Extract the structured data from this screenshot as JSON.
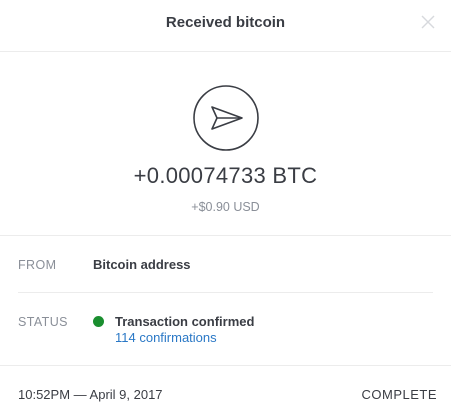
{
  "header": {
    "title": "Received bitcoin",
    "close_icon": "close-icon"
  },
  "hero": {
    "icon": "send-arrow-icon",
    "amount": "+0.00074733 BTC",
    "usd_value": "+$0.90 USD"
  },
  "details": {
    "from_label": "FROM",
    "from_value": "Bitcoin address",
    "status_label": "STATUS",
    "status_value": "Transaction confirmed",
    "status_color": "#1a8e2f",
    "confirmations": "114 confirmations"
  },
  "footer": {
    "timestamp": "10:52PM — April 9, 2017",
    "state": "COMPLETE"
  },
  "colors": {
    "link": "#2a78c6",
    "text": "#3a3d44",
    "muted": "#8a8f98"
  }
}
